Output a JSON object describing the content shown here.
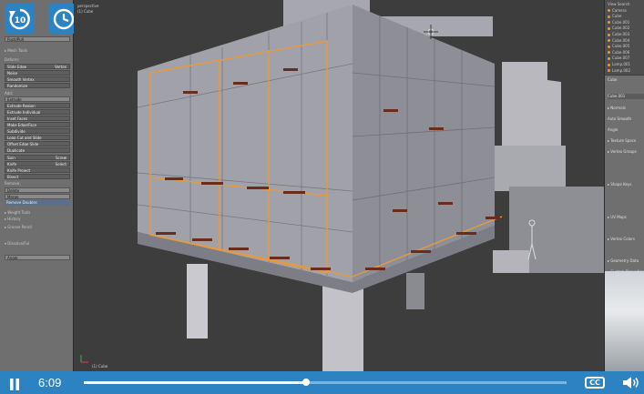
{
  "player": {
    "rewind_label": "10",
    "time": "6:09",
    "cc_label": "CC",
    "progress": 0.46
  },
  "toolpanel": {
    "rows": [
      {
        "t": "Push/Pull",
        "k": "sel"
      },
      {
        "t": "▸ Mesh Tools",
        "k": "hdr"
      },
      {
        "t": "Deform:",
        "k": "hdr"
      },
      {
        "t": "Slide Edge",
        "r": "Vertex",
        "k": "btn"
      },
      {
        "t": "Noise",
        "k": "btn"
      },
      {
        "t": "Smooth Vertex",
        "k": "btn"
      },
      {
        "t": "Randomize",
        "k": "btn"
      },
      {
        "t": "Add:",
        "k": "hdr"
      },
      {
        "t": "Extrude",
        "k": "sel"
      },
      {
        "t": "Extrude Region",
        "k": "btn"
      },
      {
        "t": "Extrude Individual",
        "k": "btn"
      },
      {
        "t": "Inset Faces",
        "k": "btn"
      },
      {
        "t": "Make Edge/Face",
        "k": "btn"
      },
      {
        "t": "Subdivide",
        "k": "btn"
      },
      {
        "t": "Loop Cut and Slide",
        "k": "btn"
      },
      {
        "t": "Offset Edge Slide",
        "k": "btn"
      },
      {
        "t": "Duplicate",
        "k": "btn"
      },
      {
        "t": "Spin",
        "r": "Screw",
        "k": "btn"
      },
      {
        "t": "Knife",
        "r": "Select",
        "k": "btn"
      },
      {
        "t": "Knife Project",
        "k": "btn"
      },
      {
        "t": "Bisect",
        "k": "btn"
      },
      {
        "t": "Remove:",
        "k": "hdr"
      },
      {
        "t": "Delete",
        "k": "sel"
      },
      {
        "t": "Merge",
        "k": "sel"
      },
      {
        "t": "Remove Doubles",
        "k": "blue"
      },
      {
        "t": "▸ Weight Tools",
        "k": "hdr"
      },
      {
        "t": "▸ History",
        "k": "hdr"
      },
      {
        "t": "▸ Grease Pencil",
        "k": "hdr"
      },
      {
        "t": "▾ Dissolve/Ful",
        "k": "hdr"
      },
      {
        "t": "Angle",
        "k": "sel"
      }
    ]
  },
  "viewport": {
    "header_line1": "perspective",
    "header_line2": "(1) Cube",
    "bottom_label": "(1) Cube"
  },
  "outliner": {
    "rows": [
      "View  Search",
      "Camera",
      "Cube",
      "Cube.001",
      "Cube.002",
      "Cube.003",
      "Cube.004",
      "Cube.005",
      "Cube.006",
      "Cube.007",
      "Lamp.001",
      "Lamp.002"
    ]
  },
  "props": {
    "object_name": "Cube",
    "mesh_name": "Cube.001",
    "rows": [
      "▸ Normals",
      "Auto Smooth",
      "Angle",
      "▸ Texture Space",
      "▸ Vertex Groups",
      "",
      "",
      "▸ Shape Keys",
      "",
      "",
      "▸ UV Maps",
      "",
      "▸ Vertex Colors",
      "",
      "▸ Geometry Data",
      "▸ Custom Properties"
    ]
  },
  "colors": {
    "accent": "#2d83c1",
    "edge_orange": "#e79a3c",
    "model_face": "#9d9da6"
  }
}
